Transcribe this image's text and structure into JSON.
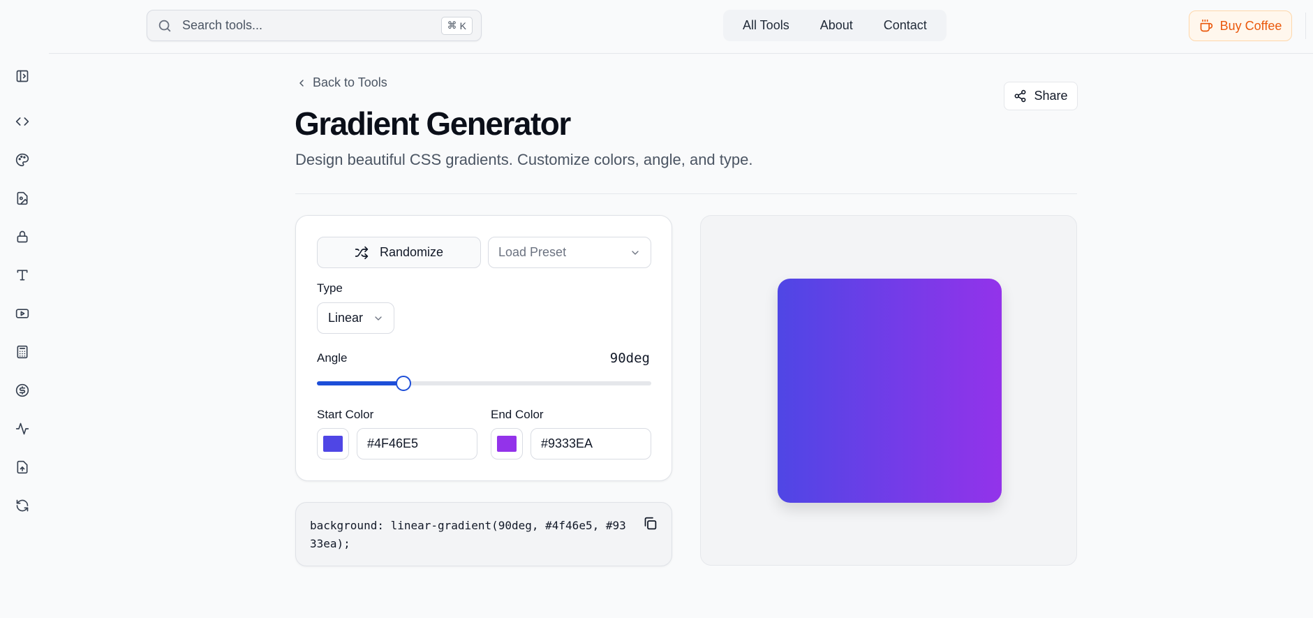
{
  "search": {
    "placeholder": "Search tools...",
    "shortcut_symbol": "⌘",
    "shortcut_key": "K"
  },
  "nav": {
    "items": [
      "All Tools",
      "About",
      "Contact"
    ]
  },
  "header": {
    "coffee_label": "Buy Coffee"
  },
  "sidebar": {
    "icons": [
      "sidebar-toggle-icon",
      "code-icon",
      "palette-icon",
      "image-icon",
      "lock-icon",
      "type-icon",
      "video-icon",
      "calculator-icon",
      "dollar-icon",
      "activity-icon",
      "file-upload-icon",
      "refresh-icon"
    ]
  },
  "page": {
    "back_label": "Back to Tools",
    "share_label": "Share",
    "title": "Gradient Generator",
    "subtitle": "Design beautiful CSS gradients. Customize colors, angle, and type."
  },
  "controls": {
    "randomize_label": "Randomize",
    "preset_placeholder": "Load Preset",
    "type_label": "Type",
    "type_value": "Linear",
    "angle_label": "Angle",
    "angle_value_text": "90deg",
    "angle_fraction": 0.25,
    "start_label": "Start Color",
    "start_hex": "#4F46E5",
    "end_label": "End Color",
    "end_hex": "#9333EA"
  },
  "colors": {
    "start": "#4f46e5",
    "end": "#9333ea",
    "accent": "#1d4ed8",
    "coffee": "#ea580c"
  },
  "code": {
    "css": "background: linear-gradient(90deg, #4f46e5, #9333ea);"
  }
}
